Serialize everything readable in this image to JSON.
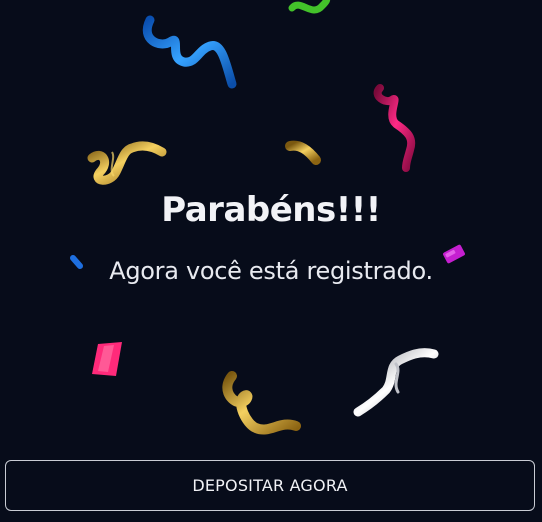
{
  "dialog": {
    "title": "Parabéns!!!",
    "message": "Agora você está registrado.",
    "cta_label": "DEPOSITAR AGORA"
  },
  "colors": {
    "background": "#070c1a",
    "text": "#f2f3f7",
    "button_border": "#c9ccd4",
    "confetti_blue": "#1e88e5",
    "confetti_green": "#43c22a",
    "confetti_magenta": "#e0126e",
    "confetti_gold": "#d6a520",
    "confetti_pink": "#ff2a7a",
    "confetti_purple": "#c51fd0",
    "confetti_silver": "#e8e8ec"
  }
}
